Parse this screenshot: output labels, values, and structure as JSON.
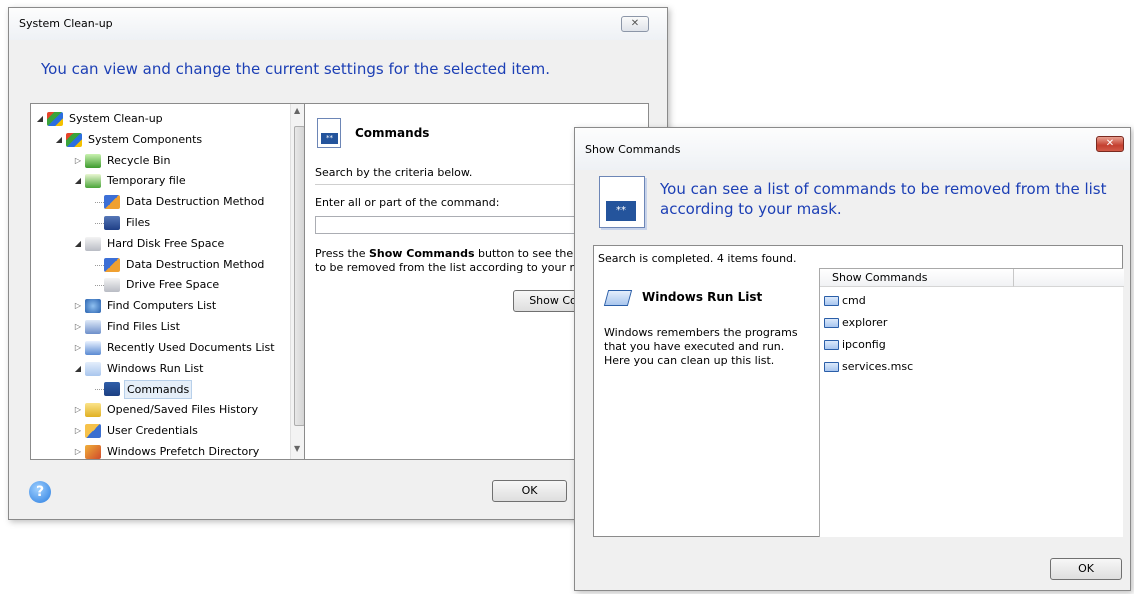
{
  "main_window": {
    "title": "System Clean-up",
    "close_glyph": "✕",
    "headline": "You can view and change the current settings for the selected item.",
    "tree": [
      {
        "label": "System Clean-up",
        "icon": "windows-flag-icon"
      },
      {
        "label": "System Components",
        "icon": "windows-flag-icon"
      },
      {
        "label": "Recycle Bin",
        "icon": "recycle-bin-icon"
      },
      {
        "label": "Temporary file",
        "icon": "temporary-file-icon"
      },
      {
        "label": "Data Destruction Method",
        "icon": "data-destruction-icon"
      },
      {
        "label": "Files",
        "icon": "files-icon"
      },
      {
        "label": "Hard Disk Free Space",
        "icon": "hard-disk-icon"
      },
      {
        "label": "Data Destruction Method",
        "icon": "data-destruction-icon"
      },
      {
        "label": "Drive Free Space",
        "icon": "drive-icon"
      },
      {
        "label": "Find Computers List",
        "icon": "find-computers-icon"
      },
      {
        "label": "Find Files List",
        "icon": "find-files-icon"
      },
      {
        "label": "Recently Used Documents List",
        "icon": "recent-docs-icon"
      },
      {
        "label": "Windows Run List",
        "icon": "run-list-icon"
      },
      {
        "label": "Commands",
        "icon": "commands-icon"
      },
      {
        "label": "Opened/Saved Files History",
        "icon": "folder-icon"
      },
      {
        "label": "User Credentials",
        "icon": "user-credentials-icon"
      },
      {
        "label": "Windows Prefetch Directory",
        "icon": "prefetch-icon"
      }
    ],
    "details": {
      "title": "Commands",
      "search_criteria": "Search by the criteria below.",
      "enter_label": "Enter all or part of the command:",
      "input_value": "",
      "desc_prefix": "Press the ",
      "desc_bold": "Show Commands",
      "desc_suffix": " button to see the",
      "desc_line2": "to be removed from the list according to your ma",
      "show_button": "Show Co"
    },
    "ok_button": "OK",
    "help_glyph": "?"
  },
  "show_commands_window": {
    "title": "Show Commands",
    "close_glyph": "✕",
    "headline_line1": "You can see a list of commands to be removed from the list",
    "headline_line2": "according to your mask.",
    "status": "Search is completed. 4 items found.",
    "left_title": "Windows Run List",
    "left_desc": [
      "Windows remembers the programs",
      "that you have executed and run.",
      "Here you can clean up this list."
    ],
    "column_header": "Show Commands",
    "commands": [
      "cmd",
      "explorer",
      "ipconfig",
      "services.msc"
    ],
    "ok_button": "OK"
  },
  "colors": {
    "headline": "#1c3fb5",
    "selection": "#e5eef8"
  }
}
